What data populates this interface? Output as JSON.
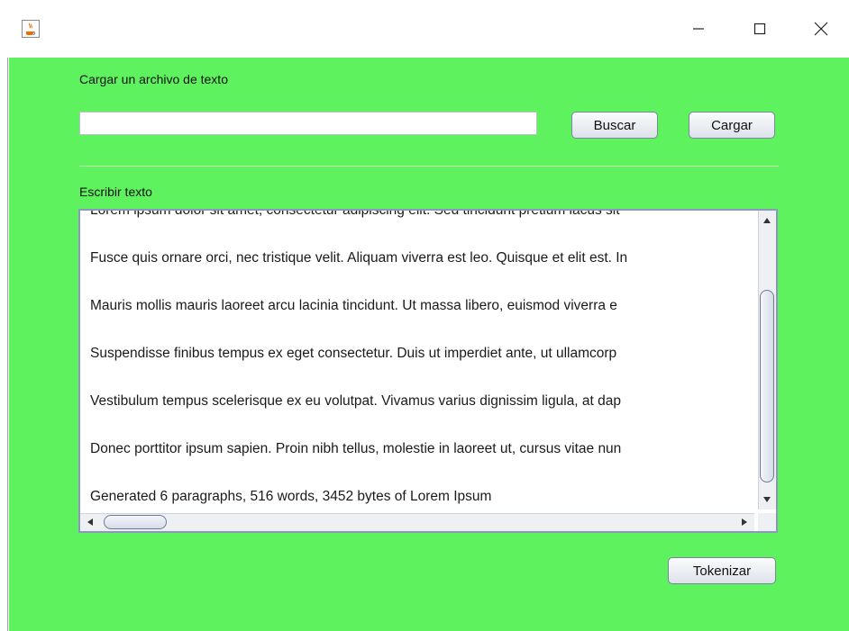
{
  "window": {
    "app_icon": "java-coffee-icon",
    "controls": [
      "minimize-icon",
      "maximize-icon",
      "close-icon"
    ]
  },
  "load_section": {
    "label": "Cargar un archivo de texto",
    "path_value": "",
    "search_button": "Buscar",
    "load_button": "Cargar"
  },
  "write_section": {
    "label": "Escribir texto",
    "paragraphs": [
      "Lorem ipsum dolor sit amet, consectetur adipiscing elit. Sed tincidunt pretium lacus sit",
      "Fusce quis ornare orci, nec tristique velit. Aliquam viverra est leo. Quisque et elit est. In",
      "Mauris mollis mauris laoreet arcu lacinia tincidunt. Ut massa libero, euismod viverra e",
      "Suspendisse finibus tempus ex eget consectetur. Duis ut imperdiet ante, ut ullamcorp",
      "Vestibulum tempus scelerisque ex eu volutpat. Vivamus varius dignissim ligula, at dap",
      "Donec porttitor ipsum sapien. Proin nibh tellus, molestie in laoreet ut, cursus vitae nun",
      "Generated 6 paragraphs, 516 words, 3452 bytes of Lorem Ipsum"
    ]
  },
  "tokenize_button": "Tokenizar",
  "colors": {
    "panel_background": "#5ef25e",
    "button_border": "#7a8699",
    "textarea_border": "#8c97c0"
  }
}
